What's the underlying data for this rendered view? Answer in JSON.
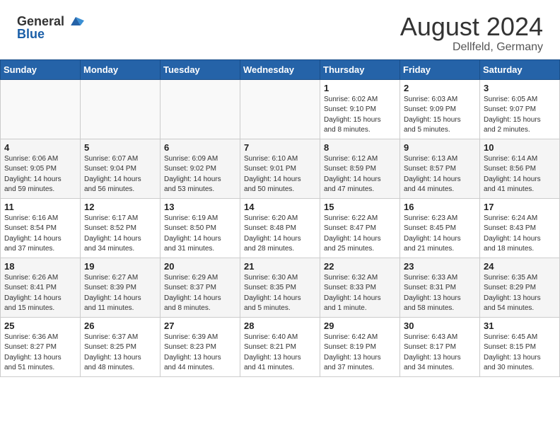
{
  "header": {
    "logo_general": "General",
    "logo_blue": "Blue",
    "title": "August 2024",
    "location": "Dellfeld, Germany"
  },
  "days_of_week": [
    "Sunday",
    "Monday",
    "Tuesday",
    "Wednesday",
    "Thursday",
    "Friday",
    "Saturday"
  ],
  "weeks": [
    [
      {
        "day": "",
        "info": ""
      },
      {
        "day": "",
        "info": ""
      },
      {
        "day": "",
        "info": ""
      },
      {
        "day": "",
        "info": ""
      },
      {
        "day": "1",
        "info": "Sunrise: 6:02 AM\nSunset: 9:10 PM\nDaylight: 15 hours\nand 8 minutes."
      },
      {
        "day": "2",
        "info": "Sunrise: 6:03 AM\nSunset: 9:09 PM\nDaylight: 15 hours\nand 5 minutes."
      },
      {
        "day": "3",
        "info": "Sunrise: 6:05 AM\nSunset: 9:07 PM\nDaylight: 15 hours\nand 2 minutes."
      }
    ],
    [
      {
        "day": "4",
        "info": "Sunrise: 6:06 AM\nSunset: 9:05 PM\nDaylight: 14 hours\nand 59 minutes."
      },
      {
        "day": "5",
        "info": "Sunrise: 6:07 AM\nSunset: 9:04 PM\nDaylight: 14 hours\nand 56 minutes."
      },
      {
        "day": "6",
        "info": "Sunrise: 6:09 AM\nSunset: 9:02 PM\nDaylight: 14 hours\nand 53 minutes."
      },
      {
        "day": "7",
        "info": "Sunrise: 6:10 AM\nSunset: 9:01 PM\nDaylight: 14 hours\nand 50 minutes."
      },
      {
        "day": "8",
        "info": "Sunrise: 6:12 AM\nSunset: 8:59 PM\nDaylight: 14 hours\nand 47 minutes."
      },
      {
        "day": "9",
        "info": "Sunrise: 6:13 AM\nSunset: 8:57 PM\nDaylight: 14 hours\nand 44 minutes."
      },
      {
        "day": "10",
        "info": "Sunrise: 6:14 AM\nSunset: 8:56 PM\nDaylight: 14 hours\nand 41 minutes."
      }
    ],
    [
      {
        "day": "11",
        "info": "Sunrise: 6:16 AM\nSunset: 8:54 PM\nDaylight: 14 hours\nand 37 minutes."
      },
      {
        "day": "12",
        "info": "Sunrise: 6:17 AM\nSunset: 8:52 PM\nDaylight: 14 hours\nand 34 minutes."
      },
      {
        "day": "13",
        "info": "Sunrise: 6:19 AM\nSunset: 8:50 PM\nDaylight: 14 hours\nand 31 minutes."
      },
      {
        "day": "14",
        "info": "Sunrise: 6:20 AM\nSunset: 8:48 PM\nDaylight: 14 hours\nand 28 minutes."
      },
      {
        "day": "15",
        "info": "Sunrise: 6:22 AM\nSunset: 8:47 PM\nDaylight: 14 hours\nand 25 minutes."
      },
      {
        "day": "16",
        "info": "Sunrise: 6:23 AM\nSunset: 8:45 PM\nDaylight: 14 hours\nand 21 minutes."
      },
      {
        "day": "17",
        "info": "Sunrise: 6:24 AM\nSunset: 8:43 PM\nDaylight: 14 hours\nand 18 minutes."
      }
    ],
    [
      {
        "day": "18",
        "info": "Sunrise: 6:26 AM\nSunset: 8:41 PM\nDaylight: 14 hours\nand 15 minutes."
      },
      {
        "day": "19",
        "info": "Sunrise: 6:27 AM\nSunset: 8:39 PM\nDaylight: 14 hours\nand 11 minutes."
      },
      {
        "day": "20",
        "info": "Sunrise: 6:29 AM\nSunset: 8:37 PM\nDaylight: 14 hours\nand 8 minutes."
      },
      {
        "day": "21",
        "info": "Sunrise: 6:30 AM\nSunset: 8:35 PM\nDaylight: 14 hours\nand 5 minutes."
      },
      {
        "day": "22",
        "info": "Sunrise: 6:32 AM\nSunset: 8:33 PM\nDaylight: 14 hours\nand 1 minute."
      },
      {
        "day": "23",
        "info": "Sunrise: 6:33 AM\nSunset: 8:31 PM\nDaylight: 13 hours\nand 58 minutes."
      },
      {
        "day": "24",
        "info": "Sunrise: 6:35 AM\nSunset: 8:29 PM\nDaylight: 13 hours\nand 54 minutes."
      }
    ],
    [
      {
        "day": "25",
        "info": "Sunrise: 6:36 AM\nSunset: 8:27 PM\nDaylight: 13 hours\nand 51 minutes."
      },
      {
        "day": "26",
        "info": "Sunrise: 6:37 AM\nSunset: 8:25 PM\nDaylight: 13 hours\nand 48 minutes."
      },
      {
        "day": "27",
        "info": "Sunrise: 6:39 AM\nSunset: 8:23 PM\nDaylight: 13 hours\nand 44 minutes."
      },
      {
        "day": "28",
        "info": "Sunrise: 6:40 AM\nSunset: 8:21 PM\nDaylight: 13 hours\nand 41 minutes."
      },
      {
        "day": "29",
        "info": "Sunrise: 6:42 AM\nSunset: 8:19 PM\nDaylight: 13 hours\nand 37 minutes."
      },
      {
        "day": "30",
        "info": "Sunrise: 6:43 AM\nSunset: 8:17 PM\nDaylight: 13 hours\nand 34 minutes."
      },
      {
        "day": "31",
        "info": "Sunrise: 6:45 AM\nSunset: 8:15 PM\nDaylight: 13 hours\nand 30 minutes."
      }
    ]
  ]
}
